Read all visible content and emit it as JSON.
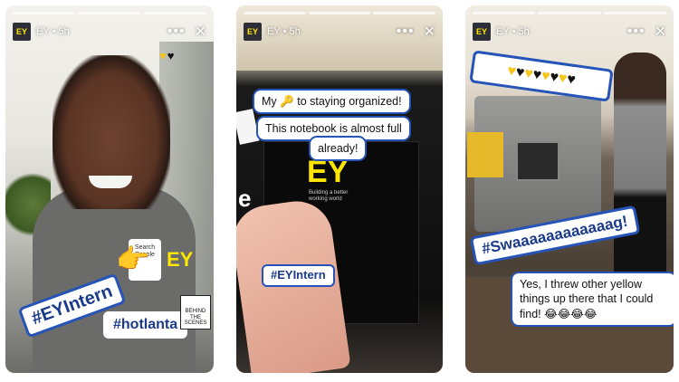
{
  "stories": [
    {
      "account": "EY",
      "time": "5h",
      "logo": "EY",
      "hearts": [
        "yellow",
        "black"
      ],
      "stickers": {
        "hashtag_main": "#EYIntern",
        "hashtag_city": "#hotlanta",
        "search_card": "Search People",
        "behind_scenes": "BEHIND THE SCENES"
      }
    },
    {
      "account": "EY",
      "time": "5h",
      "logo": "EY",
      "text_line1_before": "My",
      "text_line1_icon": "key-emoji",
      "text_line1_after": "to staying organized!",
      "text_line2": "This notebook is almost full",
      "text_line3": "already!",
      "notebook_brand": "EY",
      "notebook_tagline": "Building a better working world",
      "hashtag": "#EYIntern"
    },
    {
      "account": "EY",
      "time": "5h",
      "logo": "EY",
      "hearts": [
        "yellow",
        "black",
        "yellow",
        "black",
        "yellow",
        "black",
        "yellow",
        "black"
      ],
      "hashtag": "#Swaaaaaaaaaaaag!",
      "caption": "Yes, I threw other yellow things up there that I could find! 😂😂😂😂"
    }
  ],
  "colors": {
    "sticker_border": "#2553b8",
    "sticker_text": "#1a3a8a",
    "ey_yellow": "#ffe600"
  }
}
